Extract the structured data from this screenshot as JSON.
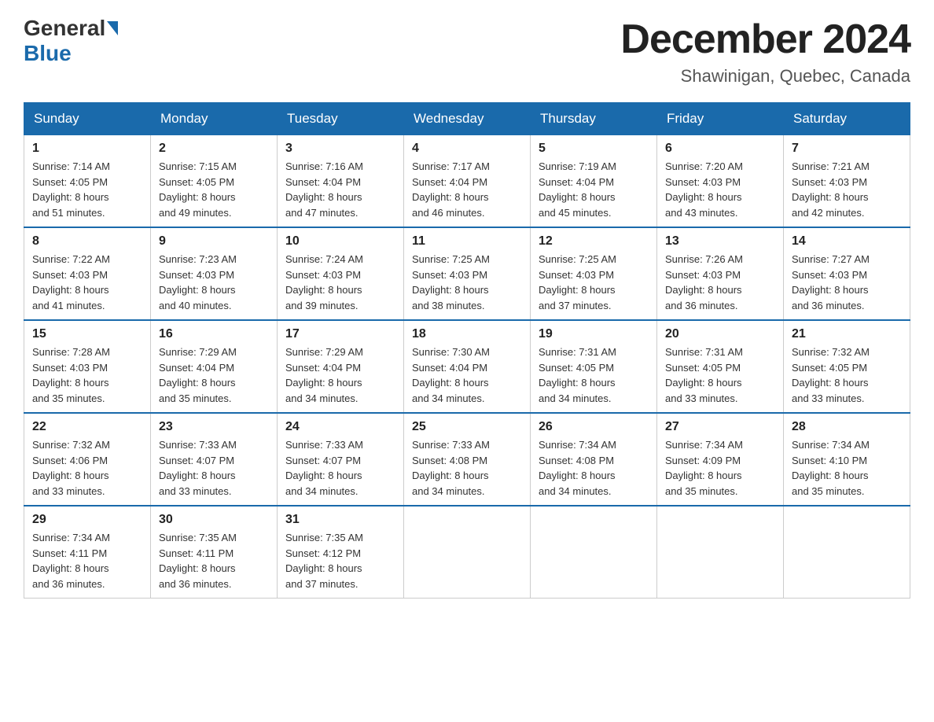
{
  "header": {
    "logo_general": "General",
    "logo_blue": "Blue",
    "month_title": "December 2024",
    "location": "Shawinigan, Quebec, Canada"
  },
  "weekdays": [
    "Sunday",
    "Monday",
    "Tuesday",
    "Wednesday",
    "Thursday",
    "Friday",
    "Saturday"
  ],
  "weeks": [
    [
      {
        "day": "1",
        "sunrise": "7:14 AM",
        "sunset": "4:05 PM",
        "daylight": "8 hours and 51 minutes."
      },
      {
        "day": "2",
        "sunrise": "7:15 AM",
        "sunset": "4:05 PM",
        "daylight": "8 hours and 49 minutes."
      },
      {
        "day": "3",
        "sunrise": "7:16 AM",
        "sunset": "4:04 PM",
        "daylight": "8 hours and 47 minutes."
      },
      {
        "day": "4",
        "sunrise": "7:17 AM",
        "sunset": "4:04 PM",
        "daylight": "8 hours and 46 minutes."
      },
      {
        "day": "5",
        "sunrise": "7:19 AM",
        "sunset": "4:04 PM",
        "daylight": "8 hours and 45 minutes."
      },
      {
        "day": "6",
        "sunrise": "7:20 AM",
        "sunset": "4:03 PM",
        "daylight": "8 hours and 43 minutes."
      },
      {
        "day": "7",
        "sunrise": "7:21 AM",
        "sunset": "4:03 PM",
        "daylight": "8 hours and 42 minutes."
      }
    ],
    [
      {
        "day": "8",
        "sunrise": "7:22 AM",
        "sunset": "4:03 PM",
        "daylight": "8 hours and 41 minutes."
      },
      {
        "day": "9",
        "sunrise": "7:23 AM",
        "sunset": "4:03 PM",
        "daylight": "8 hours and 40 minutes."
      },
      {
        "day": "10",
        "sunrise": "7:24 AM",
        "sunset": "4:03 PM",
        "daylight": "8 hours and 39 minutes."
      },
      {
        "day": "11",
        "sunrise": "7:25 AM",
        "sunset": "4:03 PM",
        "daylight": "8 hours and 38 minutes."
      },
      {
        "day": "12",
        "sunrise": "7:25 AM",
        "sunset": "4:03 PM",
        "daylight": "8 hours and 37 minutes."
      },
      {
        "day": "13",
        "sunrise": "7:26 AM",
        "sunset": "4:03 PM",
        "daylight": "8 hours and 36 minutes."
      },
      {
        "day": "14",
        "sunrise": "7:27 AM",
        "sunset": "4:03 PM",
        "daylight": "8 hours and 36 minutes."
      }
    ],
    [
      {
        "day": "15",
        "sunrise": "7:28 AM",
        "sunset": "4:03 PM",
        "daylight": "8 hours and 35 minutes."
      },
      {
        "day": "16",
        "sunrise": "7:29 AM",
        "sunset": "4:04 PM",
        "daylight": "8 hours and 35 minutes."
      },
      {
        "day": "17",
        "sunrise": "7:29 AM",
        "sunset": "4:04 PM",
        "daylight": "8 hours and 34 minutes."
      },
      {
        "day": "18",
        "sunrise": "7:30 AM",
        "sunset": "4:04 PM",
        "daylight": "8 hours and 34 minutes."
      },
      {
        "day": "19",
        "sunrise": "7:31 AM",
        "sunset": "4:05 PM",
        "daylight": "8 hours and 34 minutes."
      },
      {
        "day": "20",
        "sunrise": "7:31 AM",
        "sunset": "4:05 PM",
        "daylight": "8 hours and 33 minutes."
      },
      {
        "day": "21",
        "sunrise": "7:32 AM",
        "sunset": "4:05 PM",
        "daylight": "8 hours and 33 minutes."
      }
    ],
    [
      {
        "day": "22",
        "sunrise": "7:32 AM",
        "sunset": "4:06 PM",
        "daylight": "8 hours and 33 minutes."
      },
      {
        "day": "23",
        "sunrise": "7:33 AM",
        "sunset": "4:07 PM",
        "daylight": "8 hours and 33 minutes."
      },
      {
        "day": "24",
        "sunrise": "7:33 AM",
        "sunset": "4:07 PM",
        "daylight": "8 hours and 34 minutes."
      },
      {
        "day": "25",
        "sunrise": "7:33 AM",
        "sunset": "4:08 PM",
        "daylight": "8 hours and 34 minutes."
      },
      {
        "day": "26",
        "sunrise": "7:34 AM",
        "sunset": "4:08 PM",
        "daylight": "8 hours and 34 minutes."
      },
      {
        "day": "27",
        "sunrise": "7:34 AM",
        "sunset": "4:09 PM",
        "daylight": "8 hours and 35 minutes."
      },
      {
        "day": "28",
        "sunrise": "7:34 AM",
        "sunset": "4:10 PM",
        "daylight": "8 hours and 35 minutes."
      }
    ],
    [
      {
        "day": "29",
        "sunrise": "7:34 AM",
        "sunset": "4:11 PM",
        "daylight": "8 hours and 36 minutes."
      },
      {
        "day": "30",
        "sunrise": "7:35 AM",
        "sunset": "4:11 PM",
        "daylight": "8 hours and 36 minutes."
      },
      {
        "day": "31",
        "sunrise": "7:35 AM",
        "sunset": "4:12 PM",
        "daylight": "8 hours and 37 minutes."
      },
      null,
      null,
      null,
      null
    ]
  ],
  "labels": {
    "sunrise": "Sunrise:",
    "sunset": "Sunset:",
    "daylight": "Daylight:"
  }
}
